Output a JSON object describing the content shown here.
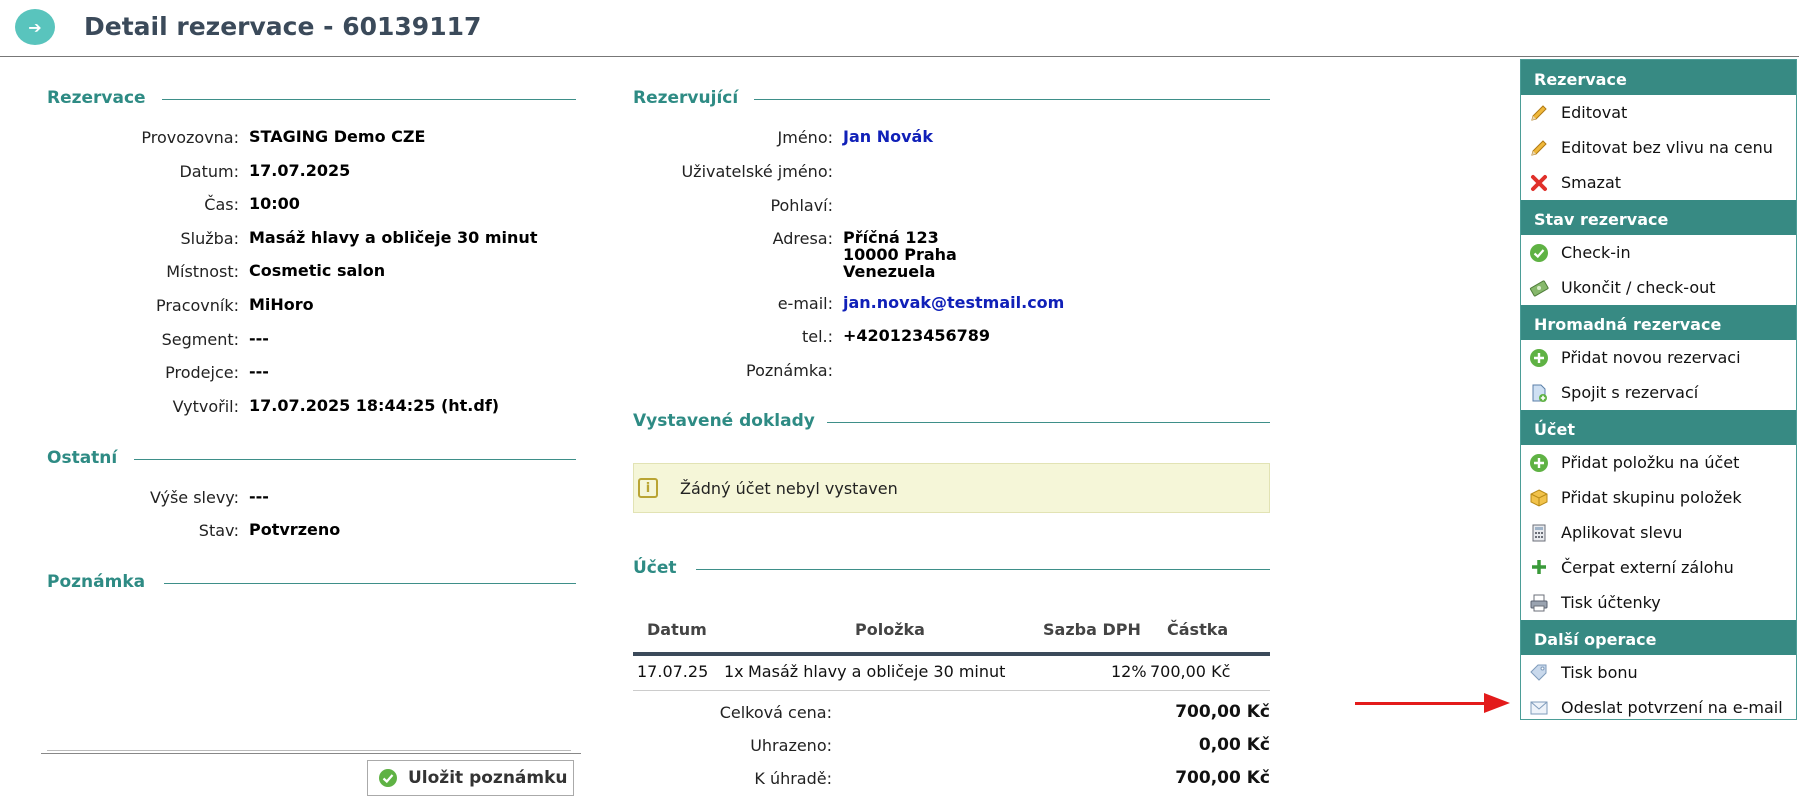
{
  "header": {
    "back_icon": "arrow-right-icon",
    "title": "Detail rezervace - 60139117"
  },
  "reservation": {
    "heading": "Rezervace",
    "fields": [
      {
        "label": "Provozovna:",
        "value": "STAGING Demo CZE"
      },
      {
        "label": "Datum:",
        "value": "17.07.2025"
      },
      {
        "label": "Čas:",
        "value": "10:00"
      },
      {
        "label": "Služba:",
        "value": "Masáž hlavy a obličeje 30 minut"
      },
      {
        "label": "Místnost:",
        "value": "Cosmetic salon"
      },
      {
        "label": "Pracovník:",
        "value": "MiHoro"
      },
      {
        "label": "Segment:",
        "value": "---"
      },
      {
        "label": "Prodejce:",
        "value": "---"
      },
      {
        "label": "Vytvořil:",
        "value": "17.07.2025 18:44:25 (ht.df)"
      }
    ]
  },
  "other": {
    "heading": "Ostatní",
    "fields": [
      {
        "label": "Výše slevy:",
        "value": "---"
      },
      {
        "label": "Stav:",
        "value": "Potvrzeno"
      }
    ]
  },
  "note": {
    "heading": "Poznámka",
    "value": "",
    "save_label": "Uložit poznámku"
  },
  "booker": {
    "heading": "Rezervující",
    "name_label": "Jméno:",
    "name": "Jan Novák",
    "username_label": "Uživatelské jméno:",
    "username": "",
    "gender_label": "Pohlaví:",
    "gender": "",
    "address_label": "Adresa:",
    "address_line1": "Příčná 123",
    "address_line2": "10000 Praha",
    "address_line3": "Venezuela",
    "email_label": "e-mail:",
    "email": "jan.novak@testmail.com",
    "phone_label": "tel.:",
    "phone": "+420123456789",
    "note_label": "Poznámka:",
    "note": ""
  },
  "documents": {
    "heading": "Vystavené doklady",
    "empty_message": "Žádný účet nebyl vystaven"
  },
  "account": {
    "heading": "Účet",
    "columns": [
      "Datum",
      "Položka",
      "Sazba DPH",
      "Částka"
    ],
    "rows": [
      {
        "date": "17.07.25",
        "qty": "1x",
        "item": "Masáž hlavy a obličeje 30 minut",
        "vat": "12%",
        "amount": "700,00 Kč"
      }
    ],
    "total_label": "Celková cena:",
    "total": "700,00 Kč",
    "paid_label": "Uhrazeno:",
    "paid": "0,00 Kč",
    "due_label": "K úhradě:",
    "due": "700,00 Kč"
  },
  "sidebar": {
    "sections": [
      {
        "title": "Rezervace",
        "items": [
          {
            "label": "Editovat",
            "icon": "pencil-icon"
          },
          {
            "label": "Editovat bez vlivu na cenu",
            "icon": "pencil-icon"
          },
          {
            "label": "Smazat",
            "icon": "delete-cross-icon"
          }
        ]
      },
      {
        "title": "Stav rezervace",
        "items": [
          {
            "label": "Check-in",
            "icon": "check-circle-icon"
          },
          {
            "label": "Ukončit / check-out",
            "icon": "money-icon"
          }
        ]
      },
      {
        "title": "Hromadná rezervace",
        "items": [
          {
            "label": "Přidat novou rezervaci",
            "icon": "add-circle-icon"
          },
          {
            "label": "Spojit s rezervací",
            "icon": "document-add-icon"
          }
        ]
      },
      {
        "title": "Účet",
        "items": [
          {
            "label": "Přidat položku na účet",
            "icon": "add-circle-icon"
          },
          {
            "label": "Přidat skupinu položek",
            "icon": "package-icon"
          },
          {
            "label": "Aplikovat slevu",
            "icon": "calculator-icon"
          },
          {
            "label": "Čerpat externí zálohu",
            "icon": "plus-icon"
          },
          {
            "label": "Tisk účtenky",
            "icon": "printer-icon"
          }
        ]
      },
      {
        "title": "Další operace",
        "items": [
          {
            "label": "Tisk bonu",
            "icon": "tag-icon"
          },
          {
            "label": "Odeslat potvrzení na e-mail",
            "icon": "envelope-icon"
          }
        ]
      }
    ]
  },
  "colors": {
    "accent": "#378a83",
    "link": "#1020b8",
    "arrow": "#e31b1b",
    "info_bg": "#f5f6d8"
  }
}
